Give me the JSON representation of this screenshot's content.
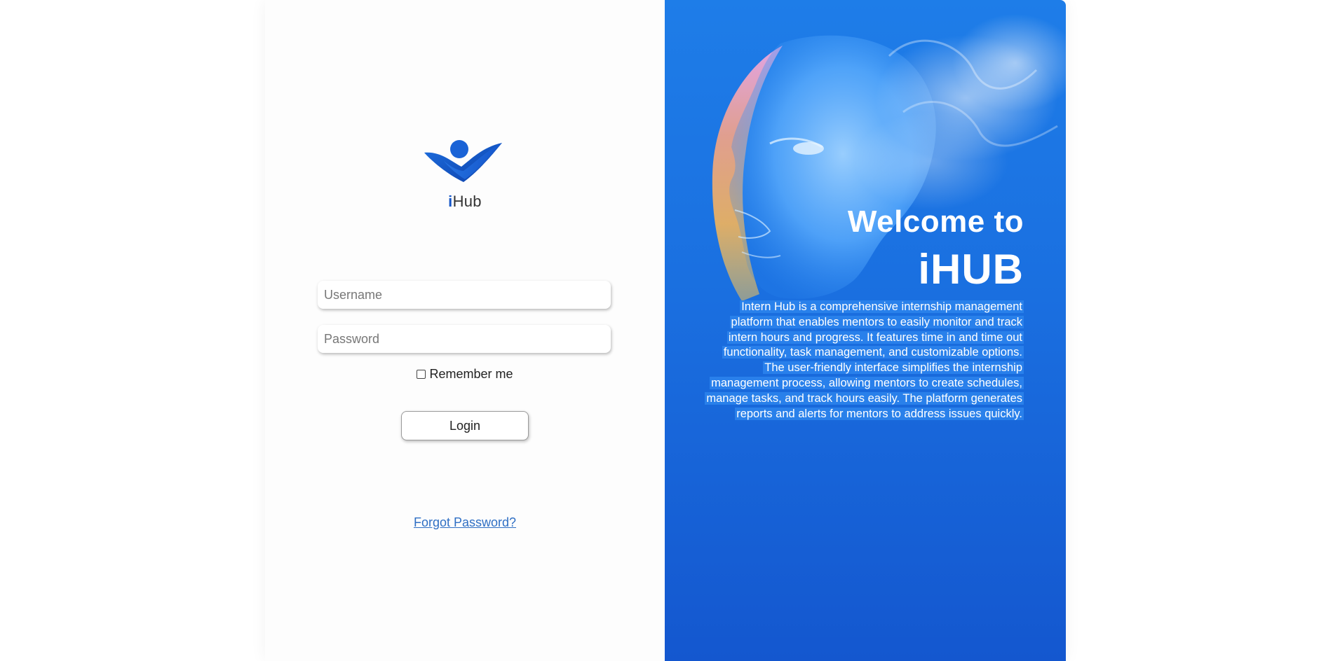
{
  "brand": {
    "logo_text_accent": "i",
    "logo_text_rest": "Hub"
  },
  "login_form": {
    "username_placeholder": "Username",
    "password_placeholder": "Password",
    "remember_label": "Remember me",
    "remember_checked": false,
    "login_label": "Login",
    "forgot_label": "Forgot Password?"
  },
  "hero": {
    "welcome_line1": "Welcome to",
    "welcome_line2": "iHUB",
    "description": "Intern Hub is a comprehensive internship management platform that enables mentors to easily monitor and track intern hours and progress. It features time in and time out functionality, task management, and customizable options. The user-friendly interface simplifies the internship management process, allowing mentors to create schedules, manage tasks, and track hours easily. The platform generates reports and alerts for mentors to address issues quickly."
  },
  "icons": {
    "logo": "ihub-logo-icon",
    "checkbox": "checkbox-icon",
    "hero_art": "face-illustration"
  },
  "colors": {
    "brand_blue": "#1556c7",
    "panel_blue_top": "#1e7de8",
    "panel_blue_bottom": "#1457cf",
    "link_blue": "#2f6fc4"
  }
}
